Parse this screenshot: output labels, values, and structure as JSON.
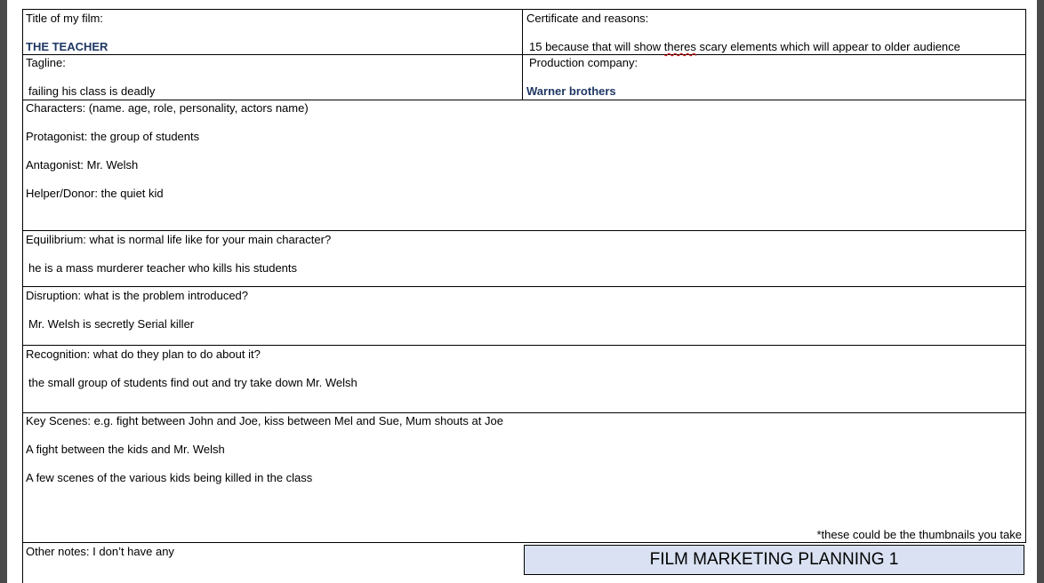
{
  "form": {
    "title_label": "Title of my film:",
    "title_value": "THE TEACHER",
    "certificate_label": "Certificate and reasons:",
    "certificate_value_before": "15 because that will show ",
    "certificate_value_misspelled": "theres",
    "certificate_value_after": " scary elements which will appear to older audience",
    "tagline_label": "Tagline:",
    "tagline_value": "failing his class is deadly",
    "production_label": "Production company:",
    "production_value": "Warner brothers",
    "characters_label": "Characters: (name. age, role, personality, actors name)",
    "protagonist": "Protagonist: the group of students",
    "antagonist": "Antagonist: Mr. Welsh",
    "helper": "Helper/Donor: the quiet kid",
    "equilibrium_label": "Equilibrium: what is normal life like for your main character?",
    "equilibrium_value": "he is a mass murderer teacher who kills his students",
    "disruption_label": "Disruption: what is the problem introduced?",
    "disruption_value": "Mr. Welsh is secretly Serial killer",
    "recognition_label": "Recognition: what do they plan to do about it?",
    "recognition_value": "the small group of students find out and try take down Mr. Welsh",
    "key_scenes_label": "Key Scenes: e.g. fight between John and Joe, kiss between Mel and Sue, Mum shouts at Joe",
    "key_scene_1": "A fight between the kids and Mr. Welsh",
    "key_scene_2": "A few scenes of the various kids being killed in the class",
    "thumbnail_note": "*these could be the thumbnails you take",
    "other_notes": "Other notes: I don’t have any",
    "sheet_title": "FILM MARKETING PLANNING 1"
  },
  "colors": {
    "accent_text": "#1f3864",
    "title_fill": "#d9e1f2",
    "spellcheck": "#d00000"
  }
}
